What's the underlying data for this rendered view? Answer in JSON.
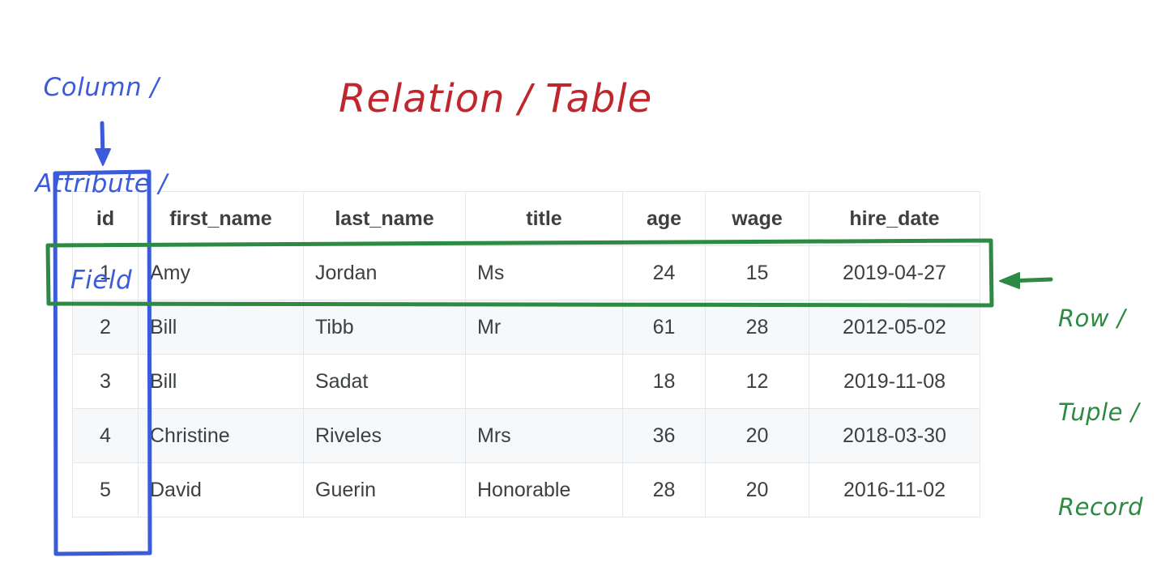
{
  "annotations": {
    "column": {
      "line1": "Column /",
      "line2": "Attribute /",
      "line3": "Field",
      "color": "#3b5bdb",
      "arrow_icon": "down-arrow-icon",
      "highlight_icon": "column-highlight-box"
    },
    "title": {
      "text": "Relation / Table",
      "color": "#c0272d"
    },
    "row": {
      "line1": "Row /",
      "line2": "Tuple /",
      "line3": "Record",
      "color": "#2d8a42",
      "arrow_icon": "left-arrow-icon",
      "highlight_icon": "row-highlight-box"
    }
  },
  "table": {
    "columns": [
      {
        "key": "id",
        "label": "id",
        "align": "center"
      },
      {
        "key": "first_name",
        "label": "first_name",
        "align": "left"
      },
      {
        "key": "last_name",
        "label": "last_name",
        "align": "left"
      },
      {
        "key": "title",
        "label": "title",
        "align": "left"
      },
      {
        "key": "age",
        "label": "age",
        "align": "center"
      },
      {
        "key": "wage",
        "label": "wage",
        "align": "center"
      },
      {
        "key": "hire_date",
        "label": "hire_date",
        "align": "center"
      }
    ],
    "rows": [
      {
        "id": "1",
        "first_name": "Amy",
        "last_name": "Jordan",
        "title": "Ms",
        "age": "24",
        "wage": "15",
        "hire_date": "2019-04-27",
        "striped": false
      },
      {
        "id": "2",
        "first_name": "Bill",
        "last_name": "Tibb",
        "title": "Mr",
        "age": "61",
        "wage": "28",
        "hire_date": "2012-05-02",
        "striped": true
      },
      {
        "id": "3",
        "first_name": "Bill",
        "last_name": "Sadat",
        "title": "",
        "age": "18",
        "wage": "12",
        "hire_date": "2019-11-08",
        "striped": false
      },
      {
        "id": "4",
        "first_name": "Christine",
        "last_name": "Riveles",
        "title": "Mrs",
        "age": "36",
        "wage": "20",
        "hire_date": "2018-03-30",
        "striped": true
      },
      {
        "id": "5",
        "first_name": "David",
        "last_name": "Guerin",
        "title": "Honorable",
        "age": "28",
        "wage": "20",
        "hire_date": "2016-11-02",
        "striped": false
      }
    ]
  },
  "colors": {
    "blue_annotation": "#3b5bdb",
    "red_title": "#c0272d",
    "green_annotation": "#2d8a42",
    "table_border": "#e4e7ea",
    "table_stripe": "#f7f8f9",
    "table_text": "#3c4043"
  }
}
